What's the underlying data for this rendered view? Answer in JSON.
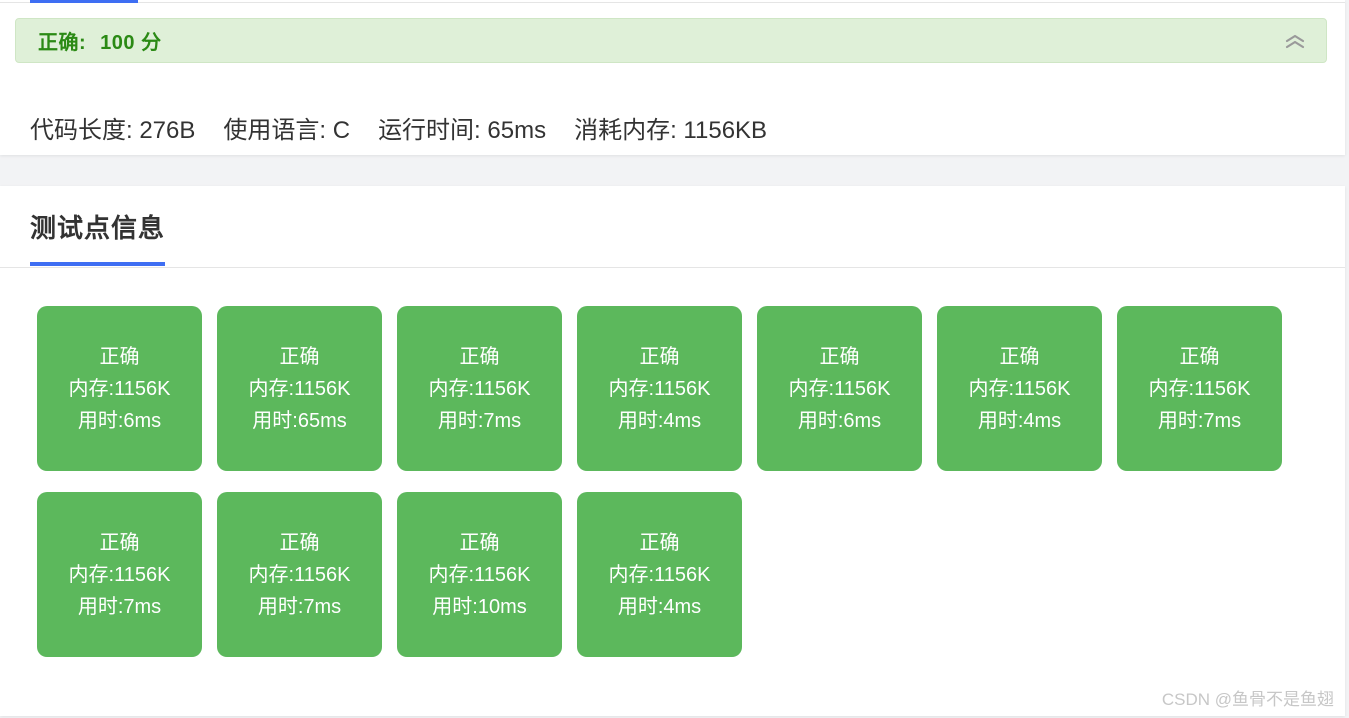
{
  "result": {
    "status": "正确:",
    "score": "100 分"
  },
  "stats": {
    "code_length": "代码长度: 276B",
    "language": "使用语言: C",
    "run_time": "运行时间: 65ms",
    "memory": "消耗内存: 1156KB"
  },
  "tests": {
    "title": "测试点信息",
    "cases": [
      {
        "status": "正确",
        "memory": "内存:1156K",
        "time": "用时:6ms"
      },
      {
        "status": "正确",
        "memory": "内存:1156K",
        "time": "用时:65ms"
      },
      {
        "status": "正确",
        "memory": "内存:1156K",
        "time": "用时:7ms"
      },
      {
        "status": "正确",
        "memory": "内存:1156K",
        "time": "用时:4ms"
      },
      {
        "status": "正确",
        "memory": "内存:1156K",
        "time": "用时:6ms"
      },
      {
        "status": "正确",
        "memory": "内存:1156K",
        "time": "用时:4ms"
      },
      {
        "status": "正确",
        "memory": "内存:1156K",
        "time": "用时:7ms"
      },
      {
        "status": "正确",
        "memory": "内存:1156K",
        "time": "用时:7ms"
      },
      {
        "status": "正确",
        "memory": "内存:1156K",
        "time": "用时:7ms"
      },
      {
        "status": "正确",
        "memory": "内存:1156K",
        "time": "用时:10ms"
      },
      {
        "status": "正确",
        "memory": "内存:1156K",
        "time": "用时:4ms"
      }
    ]
  },
  "watermark": "CSDN @鱼骨不是鱼翅",
  "colors": {
    "accent": "#3e6ef3",
    "success_tile": "#5cb85c",
    "success_text": "#2b8a15",
    "success_bg": "#dff0d8"
  },
  "icons": {
    "collapse": "chevron-double-up-icon"
  }
}
